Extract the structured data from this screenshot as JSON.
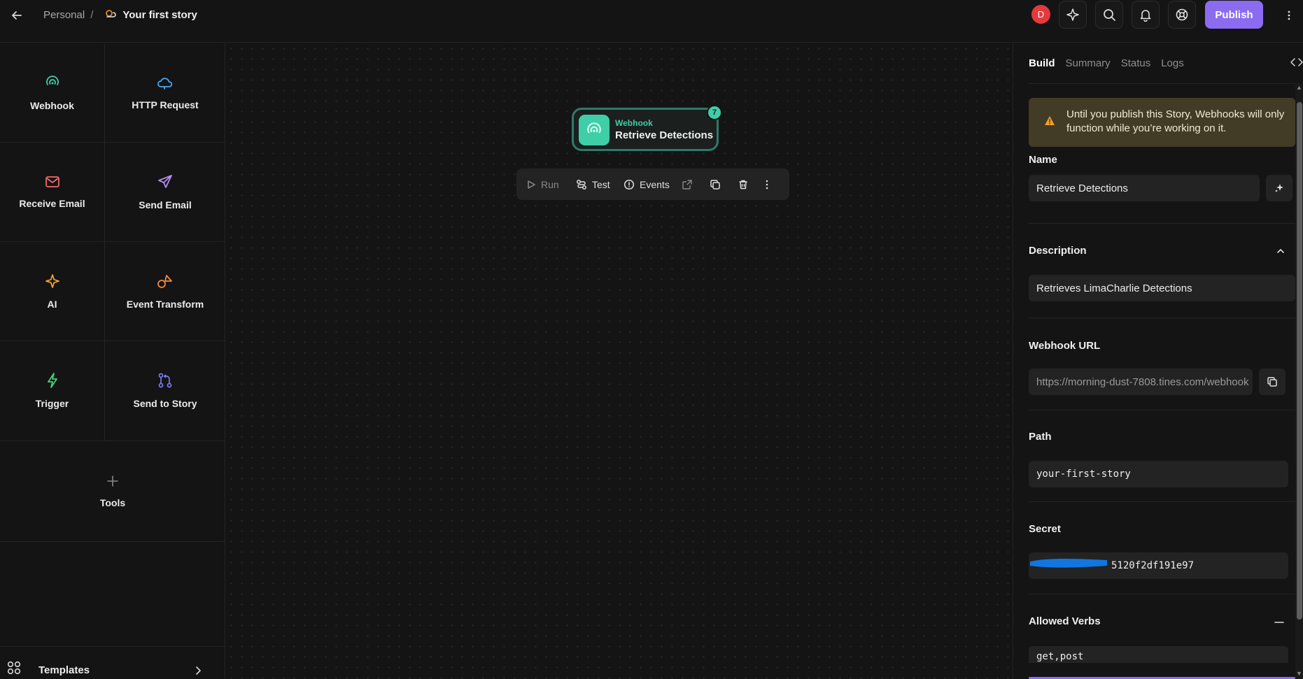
{
  "topbar": {
    "breadcrumb_parent": "Personal",
    "breadcrumb_separator": "/",
    "story_title": "Your first story",
    "avatar_initial": "D",
    "publish_label": "Publish",
    "publish_color": "#8b6cf0",
    "icons": [
      "back-arrow-icon",
      "sparkle-icon",
      "search-icon",
      "bell-icon",
      "help-lifebuoy-icon",
      "more-vertical-icon"
    ]
  },
  "palette": {
    "items": [
      {
        "label": "Webhook",
        "icon": "webhook-icon",
        "color": "#3fcfa8"
      },
      {
        "label": "HTTP Request",
        "icon": "cloud-icon",
        "color": "#4aa8f0"
      },
      {
        "label": "Receive Email",
        "icon": "mail-icon",
        "color": "#f06a6a"
      },
      {
        "label": "Send Email",
        "icon": "send-icon",
        "color": "#b58cf5"
      },
      {
        "label": "AI",
        "icon": "sparkle-icon",
        "color": "#f0a030"
      },
      {
        "label": "Event Transform",
        "icon": "shapes-icon",
        "color": "#f08a40"
      },
      {
        "label": "Trigger",
        "icon": "lightning-icon",
        "color": "#46d07a"
      },
      {
        "label": "Send to Story",
        "icon": "git-branch-icon",
        "color": "#7a7df0"
      },
      {
        "label": "Tools",
        "icon": "plus-icon",
        "color": "#8a8a8a"
      }
    ],
    "templates_label": "Templates"
  },
  "canvas": {
    "node": {
      "type": "Webhook",
      "name": "Retrieve Detections",
      "badge": "7",
      "accent": "#3fcfa8"
    },
    "toolbar": {
      "run": "Run",
      "test": "Test",
      "events": "Events"
    }
  },
  "panel": {
    "tabs": [
      {
        "label": "Build",
        "active": true
      },
      {
        "label": "Summary",
        "active": false
      },
      {
        "label": "Status",
        "active": false
      },
      {
        "label": "Logs",
        "active": false
      }
    ],
    "warning": "Until you publish this Story, Webhooks will only function while you’re working on it.",
    "name_label": "Name",
    "name_value": "Retrieve Detections",
    "description_label": "Description",
    "description_value": "Retrieves LimaCharlie Detections",
    "webhook_url_label": "Webhook URL",
    "webhook_url_value": "https://morning-dust-7808.tines.com/webhook",
    "path_label": "Path",
    "path_value": "your-first-story",
    "secret_label": "Secret",
    "secret_visible_tail": "5120f2df191e97",
    "allowed_verbs_label": "Allowed Verbs",
    "allowed_verbs_value": "get,post"
  }
}
